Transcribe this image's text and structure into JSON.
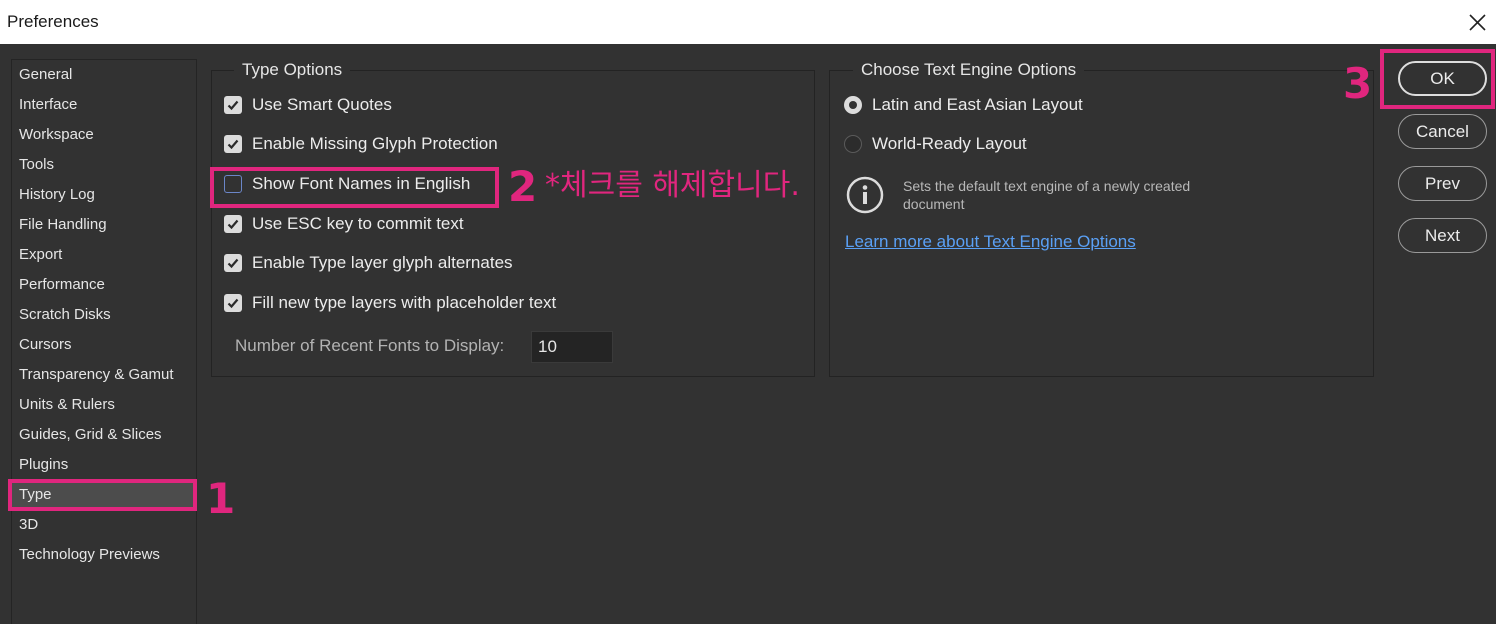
{
  "window": {
    "title": "Preferences"
  },
  "sidebar": {
    "items": [
      {
        "label": "General"
      },
      {
        "label": "Interface"
      },
      {
        "label": "Workspace"
      },
      {
        "label": "Tools"
      },
      {
        "label": "History Log"
      },
      {
        "label": "File Handling"
      },
      {
        "label": "Export"
      },
      {
        "label": "Performance"
      },
      {
        "label": "Scratch Disks"
      },
      {
        "label": "Cursors"
      },
      {
        "label": "Transparency & Gamut"
      },
      {
        "label": "Units & Rulers"
      },
      {
        "label": "Guides, Grid & Slices"
      },
      {
        "label": "Plugins"
      },
      {
        "label": "Type",
        "selected": true
      },
      {
        "label": "3D"
      },
      {
        "label": "Technology Previews"
      }
    ]
  },
  "type_options": {
    "legend": "Type Options",
    "options": [
      {
        "label": "Use Smart Quotes",
        "checked": true
      },
      {
        "label": "Enable Missing Glyph Protection",
        "checked": true
      },
      {
        "label": "Show Font Names in English",
        "checked": false
      },
      {
        "label": "Use ESC key to commit text",
        "checked": true
      },
      {
        "label": "Enable Type layer glyph alternates",
        "checked": true
      },
      {
        "label": "Fill new type layers with placeholder text",
        "checked": true
      }
    ],
    "recent_fonts_label": "Number of Recent Fonts to Display:",
    "recent_fonts_value": "10"
  },
  "text_engine": {
    "legend": "Choose Text Engine Options",
    "options": [
      {
        "label": "Latin and East Asian Layout",
        "selected": true
      },
      {
        "label": "World-Ready Layout",
        "selected": false
      }
    ],
    "info_text": "Sets the default text engine of a newly created document",
    "learn_more_link": "Learn more about Text Engine Options"
  },
  "buttons": {
    "ok": "OK",
    "cancel": "Cancel",
    "prev": "Prev",
    "next": "Next"
  },
  "annotations": {
    "step1": "1",
    "step2": "2",
    "step3": "3",
    "note": "*체크를 해제합니다.",
    "color": "#e0267e"
  },
  "colors": {
    "dialog_bg": "#323232",
    "selected_item_bg": "#4c4c4c",
    "link": "#5aa0f5"
  },
  "icons": {
    "close": "close-icon",
    "check": "checkmark-icon",
    "info": "info-icon"
  }
}
